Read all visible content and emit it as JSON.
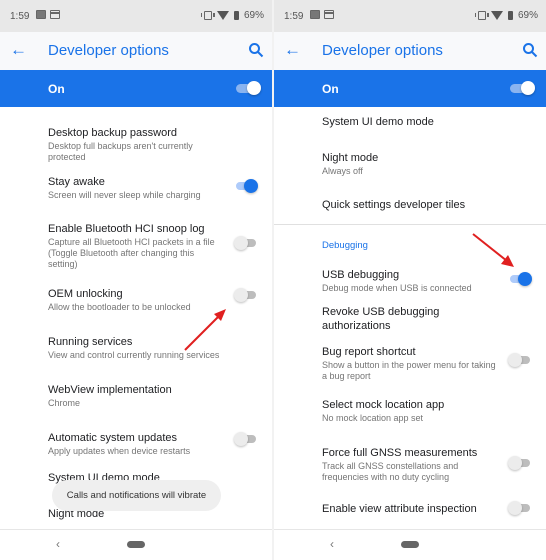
{
  "colors": {
    "accent": "#1a73e8",
    "annotation_arrow": "#e02020"
  },
  "left": {
    "status": {
      "time": "1:59",
      "battery": "69%"
    },
    "appbar": {
      "title": "Developer options"
    },
    "master": {
      "label": "On",
      "checked": true
    },
    "items": [
      {
        "title": "Desktop backup password",
        "summary": "Desktop full backups aren't currently protected"
      },
      {
        "title": "Stay awake",
        "summary": "Screen will never sleep while charging",
        "toggle": true
      },
      {
        "title": "Enable Bluetooth HCI snoop log",
        "summary": "Capture all Bluetooth HCI packets in a file (Toggle Bluetooth after changing this setting)",
        "toggle": false
      },
      {
        "title": "OEM unlocking",
        "summary": "Allow the bootloader to be unlocked",
        "toggle": false
      },
      {
        "title": "Running services",
        "summary": "View and control currently running services"
      },
      {
        "title": "WebView implementation",
        "summary": "Chrome"
      },
      {
        "title": "Automatic system updates",
        "summary": "Apply updates when device restarts",
        "toggle": false
      },
      {
        "title": "System UI demo mode"
      },
      {
        "title": "Night mode"
      }
    ],
    "toast": "Calls and notifications will vibrate"
  },
  "right": {
    "status": {
      "time": "1:59",
      "battery": "69%"
    },
    "appbar": {
      "title": "Developer options"
    },
    "master": {
      "label": "On",
      "checked": true
    },
    "items_top": [
      {
        "title": "System UI demo mode"
      },
      {
        "title": "Night mode",
        "summary": "Always off"
      },
      {
        "title": "Quick settings developer tiles"
      }
    ],
    "section": "Debugging",
    "items_debug": [
      {
        "title": "USB debugging",
        "summary": "Debug mode when USB is connected",
        "toggle": true
      },
      {
        "title": "Revoke USB debugging authorizations"
      },
      {
        "title": "Bug report shortcut",
        "summary": "Show a button in the power menu for taking a bug report",
        "toggle": false
      },
      {
        "title": "Select mock location app",
        "summary": "No mock location app set"
      },
      {
        "title": "Force full GNSS measurements",
        "summary": "Track all GNSS constellations and frequencies with no duty cycling",
        "toggle": false
      },
      {
        "title": "Enable view attribute inspection",
        "toggle": false
      }
    ]
  },
  "icons": {
    "back": "arrow-left",
    "search": "magnifier",
    "nav_back": "chevron-left",
    "nav_home": "pill"
  },
  "nav": {
    "back_glyph": "‹"
  }
}
